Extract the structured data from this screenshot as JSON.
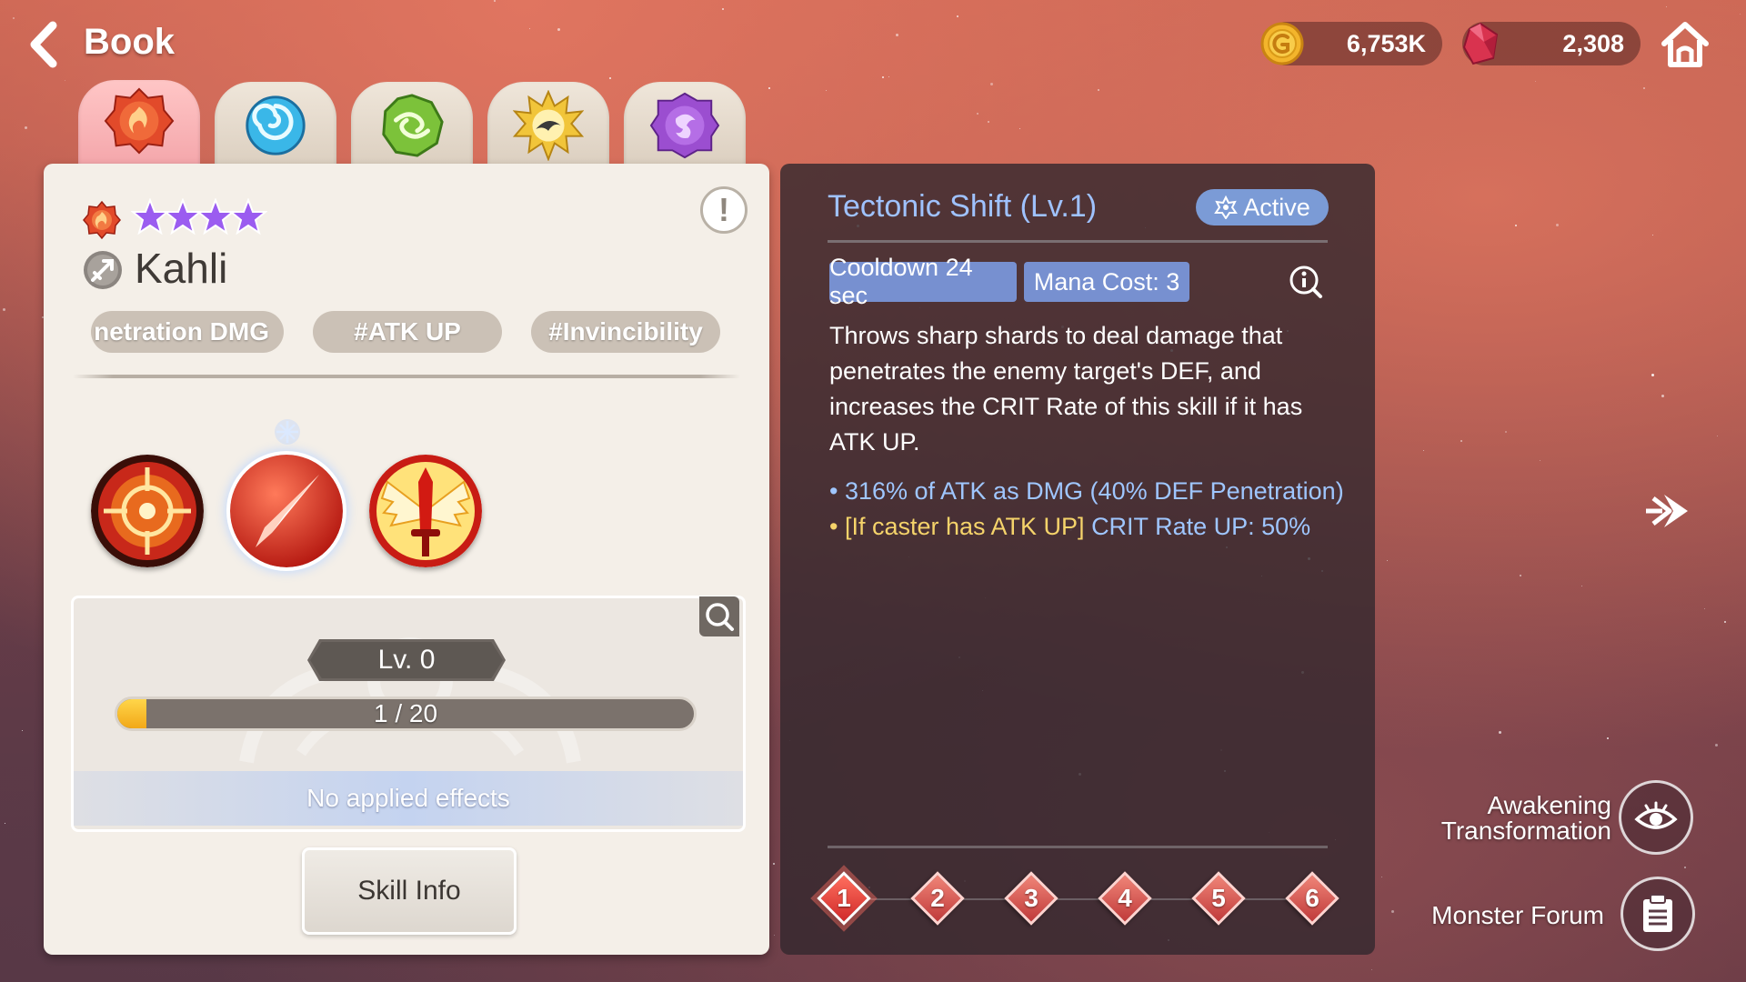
{
  "header": {
    "title": "Book",
    "gold": "6,753K",
    "crystals": "2,308"
  },
  "tabs": [
    {
      "element": "fire",
      "icon": "fire-element-icon",
      "active": true
    },
    {
      "element": "water",
      "icon": "water-element-icon",
      "active": false
    },
    {
      "element": "wind",
      "icon": "wind-element-icon",
      "active": false
    },
    {
      "element": "light",
      "icon": "light-element-icon",
      "active": false
    },
    {
      "element": "dark",
      "icon": "dark-element-icon",
      "active": false
    }
  ],
  "monster": {
    "name": "Kahli",
    "element": "fire",
    "stars": 4,
    "class_icon": "attack-class-icon",
    "tags": [
      "netration DMG",
      "#ATK UP",
      "#Invincibility"
    ],
    "skills": [
      {
        "icon": "target-skill-icon",
        "selected": false
      },
      {
        "icon": "shard-skill-icon",
        "selected": true
      },
      {
        "icon": "winged-sword-skill-icon",
        "selected": false
      }
    ],
    "level_label": "Lv. 0",
    "progress_text": "1 / 20",
    "progress_fraction": 0.05,
    "effects_text": "No applied effects",
    "skill_info_label": "Skill Info"
  },
  "skill_detail": {
    "title": "Tectonic Shift (Lv.1)",
    "type_badge": "Active",
    "cooldown": "Cooldown 24 sec",
    "mana_cost": "Mana Cost: 3",
    "description": "Throws sharp shards to deal damage that penetrates the enemy target's DEF, and increases the CRIT Rate of this skill if it has ATK UP.",
    "effect_1": "• 316% of ATK as DMG (40% DEF Penetration)",
    "effect_2_prefix": "• [If caster has ATK UP] ",
    "effect_2_value": "CRIT Rate UP: 50%",
    "levels": [
      "1",
      "2",
      "3",
      "4",
      "5",
      "6"
    ],
    "selected_level": "1"
  },
  "side": {
    "awakening_line1": "Awakening",
    "awakening_line2": "Transformation",
    "forum_label": "Monster Forum"
  },
  "colors": {
    "accent_blue": "#9fc2ff",
    "highlight_yellow": "#f5d36a",
    "active_badge": "#7b9bd6",
    "level_diamond": "#d02a2a"
  }
}
